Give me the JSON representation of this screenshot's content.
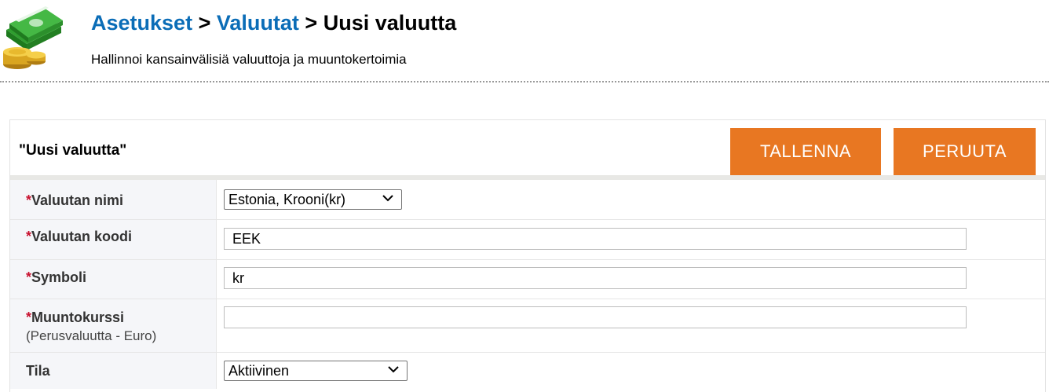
{
  "header": {
    "breadcrumb": {
      "settings": "Asetukset",
      "currencies": "Valuutat",
      "current": "Uusi valuutta",
      "separator": ">"
    },
    "subtitle": "Hallinnoi kansainvälisiä valuuttoja ja muuntokertoimia"
  },
  "panel": {
    "title": "\"Uusi valuutta\"",
    "save_label": "TALLENNA",
    "cancel_label": "PERUUTA"
  },
  "form": {
    "required_mark": "*",
    "currency_name": {
      "label": "Valuutan nimi",
      "value": "Estonia, Krooni(kr)"
    },
    "currency_code": {
      "label": "Valuutan koodi",
      "value": "EEK"
    },
    "symbol": {
      "label": "Symboli",
      "value": "kr"
    },
    "conversion_rate": {
      "label": "Muuntokurssi",
      "sublabel": "(Perusvaluutta - Euro)",
      "value": ""
    },
    "status": {
      "label": "Tila",
      "value": "Aktiivinen"
    }
  },
  "colors": {
    "link": "#0b6db7",
    "button": "#e87722",
    "required": "#c8102e"
  },
  "icons": {
    "logo": "money-stack-coins-icon",
    "dropdown": "chevron-down-icon"
  }
}
